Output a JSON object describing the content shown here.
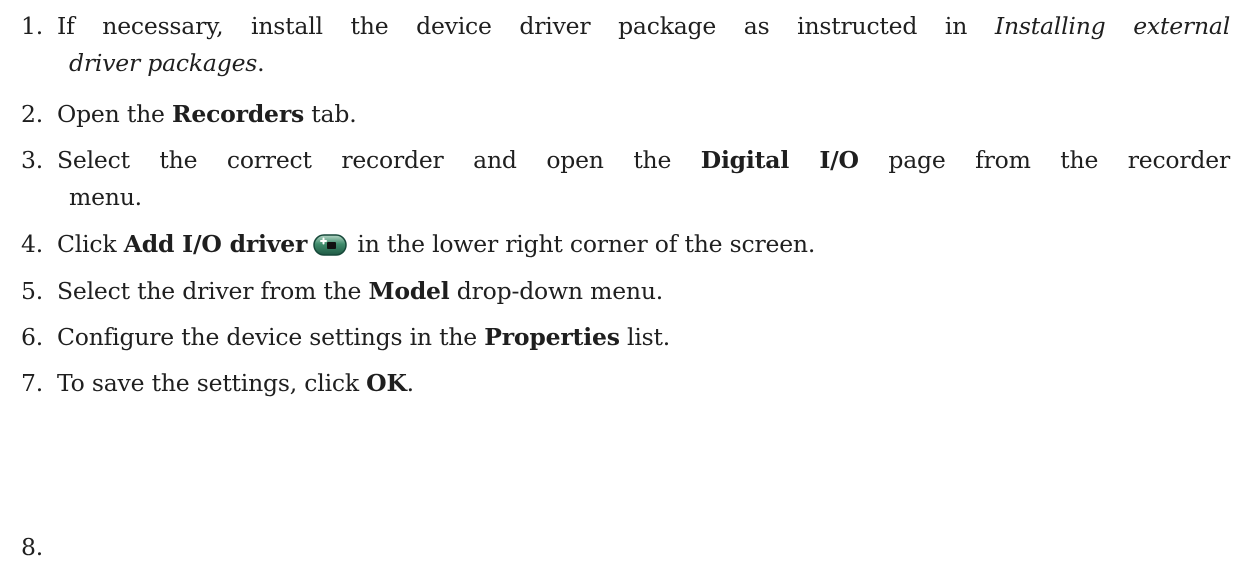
{
  "steps": [
    {
      "number": "1.",
      "text_a": "If necessary, install the device driver package as instructed in ",
      "italic_a": "Installing external",
      "italic_b": "driver packages",
      "text_b": "."
    },
    {
      "number": "2.",
      "text_a": "Open the ",
      "bold": "Recorders",
      "text_b": " tab."
    },
    {
      "number": "3.",
      "text_a": "Select the correct recorder and open the ",
      "bold": "Digital I/O",
      "text_b": " page from the recorder",
      "text_c": "menu."
    },
    {
      "number": "4.",
      "text_a": "Click ",
      "bold": "Add I/O driver",
      "icon": "add-io-driver-icon",
      "text_b": " in the lower right corner of the screen."
    },
    {
      "number": "5.",
      "text_a": "Select the driver from the ",
      "bold": "Model",
      "text_b": " drop-down menu."
    },
    {
      "number": "6.",
      "text_a": "Configure the device settings in the ",
      "bold": "Properties",
      "text_b": " list."
    },
    {
      "number": "7.",
      "text_a": "To save the settings, click ",
      "bold": "OK",
      "text_b": "."
    },
    {
      "number": "8."
    }
  ],
  "colors": {
    "text": "#1f1f1f",
    "icon_fill": "#2f7d5f",
    "icon_border": "#17493a"
  }
}
